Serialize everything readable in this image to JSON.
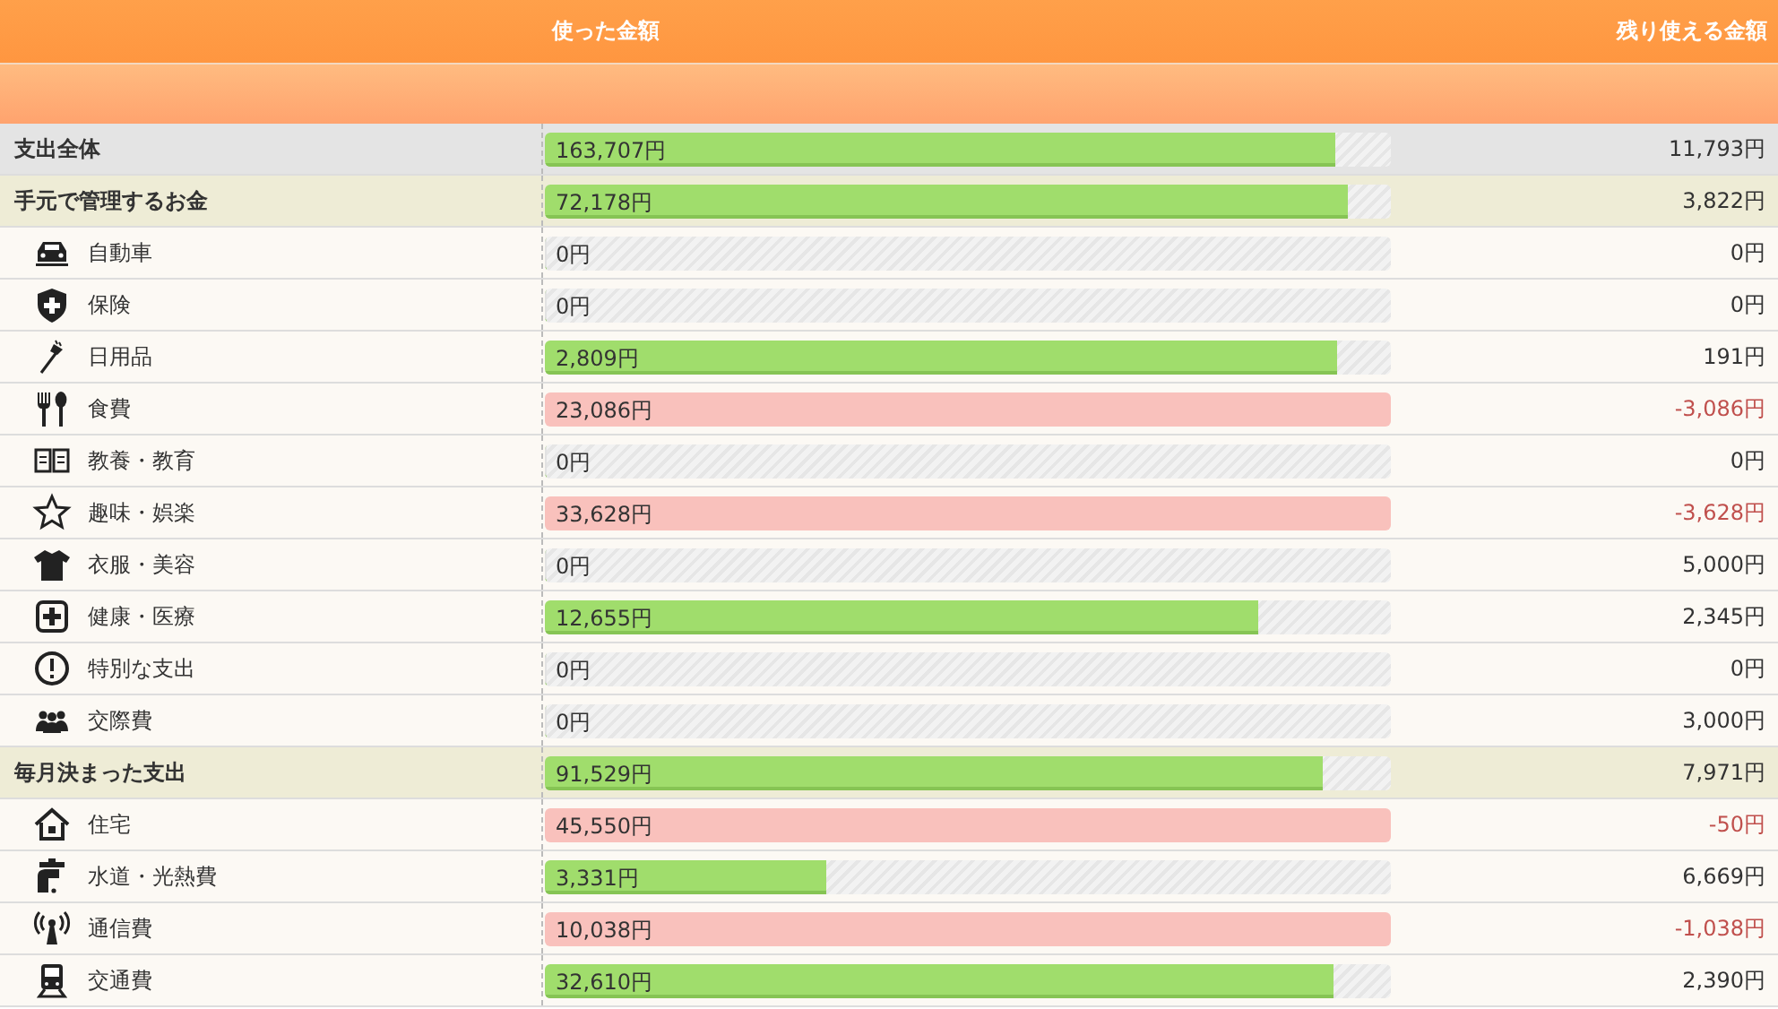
{
  "header": {
    "spent_label": "使った金額",
    "remaining_label": "残り使える金額"
  },
  "rows": [
    {
      "kind": "total",
      "label": "支出全体",
      "spent": "163,707円",
      "level": 0.934,
      "over": false,
      "remaining": "11,793円"
    },
    {
      "kind": "group",
      "label": "手元で管理するお金",
      "spent": "72,178円",
      "level": 0.95,
      "over": false,
      "remaining": "3,822円"
    },
    {
      "kind": "item",
      "label": "自動車",
      "spent": "0円",
      "level": 0,
      "over": false,
      "remaining": "0円"
    },
    {
      "kind": "item",
      "label": "保険",
      "spent": "0円",
      "level": 0,
      "over": false,
      "remaining": "0円"
    },
    {
      "kind": "item",
      "label": "日用品",
      "spent": "2,809円",
      "level": 0.936,
      "over": false,
      "remaining": "191円"
    },
    {
      "kind": "item",
      "label": "食費",
      "spent": "23,086円",
      "level": 1,
      "over": true,
      "remaining": "-3,086円"
    },
    {
      "kind": "item",
      "label": "教養・教育",
      "spent": "0円",
      "level": 0,
      "over": false,
      "remaining": "0円"
    },
    {
      "kind": "item",
      "label": "趣味・娯楽",
      "spent": "33,628円",
      "level": 1,
      "over": true,
      "remaining": "-3,628円"
    },
    {
      "kind": "item",
      "label": "衣服・美容",
      "spent": "0円",
      "level": 0,
      "over": false,
      "remaining": "5,000円"
    },
    {
      "kind": "item",
      "label": "健康・医療",
      "spent": "12,655円",
      "level": 0.844,
      "over": false,
      "remaining": "2,345円"
    },
    {
      "kind": "item",
      "label": "特別な支出",
      "spent": "0円",
      "level": 0,
      "over": false,
      "remaining": "0円"
    },
    {
      "kind": "item",
      "label": "交際費",
      "spent": "0円",
      "level": 0,
      "over": false,
      "remaining": "3,000円"
    },
    {
      "kind": "group",
      "label": "毎月決まった支出",
      "spent": "91,529円",
      "level": 0.92,
      "over": false,
      "remaining": "7,971円"
    },
    {
      "kind": "item",
      "label": "住宅",
      "spent": "45,550円",
      "level": 1,
      "over": true,
      "remaining": "-50円"
    },
    {
      "kind": "item",
      "label": "水道・光熱費",
      "spent": "3,331円",
      "level": 0.333,
      "over": false,
      "remaining": "6,669円"
    },
    {
      "kind": "item",
      "label": "通信費",
      "spent": "10,038円",
      "level": 1,
      "over": true,
      "remaining": "-1,038円"
    },
    {
      "kind": "item",
      "label": "交通費",
      "spent": "32,610円",
      "level": 0.932,
      "over": false,
      "remaining": "2,390円"
    }
  ]
}
